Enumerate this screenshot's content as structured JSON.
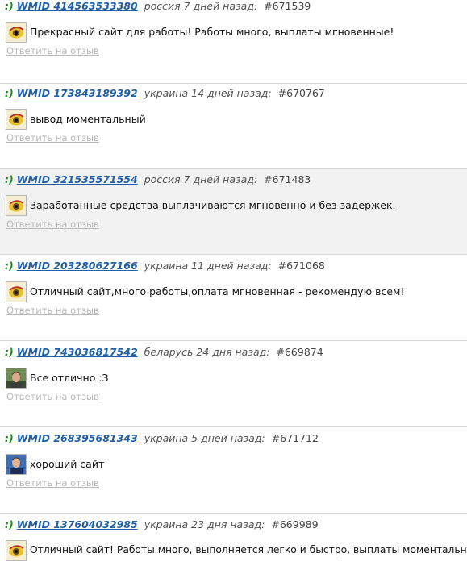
{
  "reply_label": "Ответить на отзыв",
  "colors": {
    "smile": "#1a8a1a",
    "wmid_link": "#1f5fa8",
    "reply_link": "#b9b9b9",
    "shaded_row": "#f2f2f2"
  },
  "reviews": [
    {
      "smile": ":)",
      "wmid": "WMID 414563533380",
      "meta": "россия 7 дней назад:",
      "id": "#671539",
      "avatar": "webmoney-eye-icon",
      "text": "Прекрасный сайт для работы! Работы много, выплаты мгновенные!"
    },
    {
      "smile": ":)",
      "wmid": "WMID 173843189392",
      "meta": "украина 14 дней назад:",
      "id": "#670767",
      "avatar": "webmoney-eye-icon",
      "text": "вывод моментальный"
    },
    {
      "smile": ":)",
      "wmid": "WMID 321535571554",
      "meta": "россия 7 дней назад:",
      "id": "#671483",
      "avatar": "webmoney-eye-icon",
      "text": "Заработанные средства выплачиваются мгновенно и без задержек."
    },
    {
      "smile": ":)",
      "wmid": "WMID 203280627166",
      "meta": "украина 11 дней назад:",
      "id": "#671068",
      "avatar": "webmoney-eye-icon",
      "text": "Отличный сайт,много работы,оплата мгновенная - рекомендую всем!"
    },
    {
      "smile": ":)",
      "wmid": "WMID 743036817542",
      "meta": "беларусь 24 дня назад:",
      "id": "#669874",
      "avatar": "user-photo",
      "text": "Все отлично :З"
    },
    {
      "smile": ":)",
      "wmid": "WMID 268395681343",
      "meta": "украина 5 дней назад:",
      "id": "#671712",
      "avatar": "user-photo",
      "text": "хороший сайт"
    },
    {
      "smile": ":)",
      "wmid": "WMID 137604032985",
      "meta": "украина 23 дня назад:",
      "id": "#669989",
      "avatar": "webmoney-eye-icon",
      "text": "Отличный сайт! Работы много, выполняется легко и быстро, выплаты моментальные."
    }
  ]
}
